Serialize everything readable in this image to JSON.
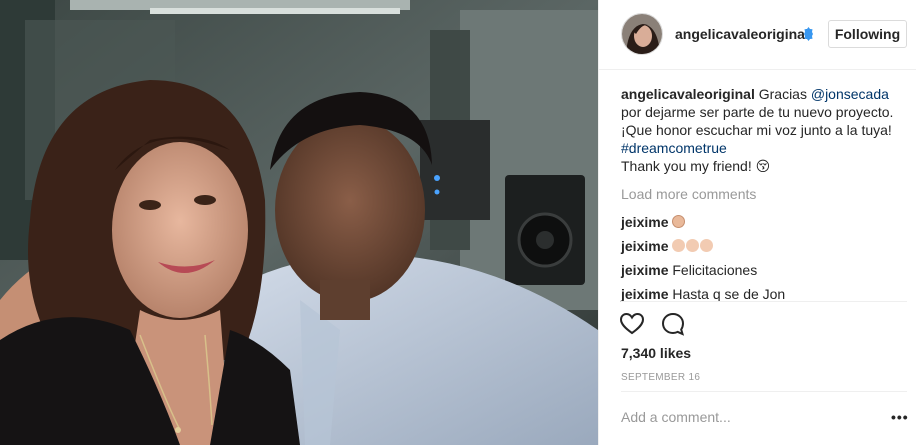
{
  "post": {
    "username": "angelicavaleoriginal",
    "follow_label": "Following",
    "caption": {
      "username": "angelicavaleoriginal",
      "text_1": "Gracias ",
      "mention": "@jonsecada",
      "text_2": " por dejarme ser parte de tu nuevo proyecto. ¡Que honor escuchar mi voz junto a la tuya! ",
      "hashtag": "#dreamcometrue",
      "text_3": "Thank you my friend! 😚"
    },
    "load_more_label": "Load more comments",
    "comments": [
      {
        "user": "jeixime",
        "text": ""
      },
      {
        "user": "jeixime",
        "text": ""
      },
      {
        "user": "jeixime",
        "text": "Felicitaciones"
      },
      {
        "user": "jeixime",
        "text": "Hasta q se de Jon"
      }
    ],
    "likes": "7,340 likes",
    "date": "SEPTEMBER 16",
    "add_comment_placeholder": "Add a comment...",
    "more_label": "•••"
  },
  "icons": {
    "verified": "verified-badge-icon",
    "like": "heart-icon",
    "comment": "comment-bubble-icon",
    "more": "more-options-icon"
  },
  "colors": {
    "link": "#003569",
    "verified": "#3897f0",
    "muted": "#999999",
    "text": "#262626"
  }
}
